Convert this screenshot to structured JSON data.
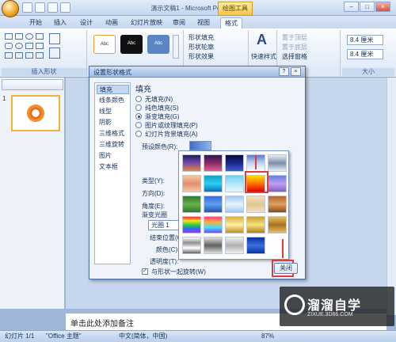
{
  "window": {
    "title": "演示文稿1 - Microsoft PowerPoint",
    "context_tab": "绘图工具"
  },
  "ribbon_tabs": [
    "开始",
    "插入",
    "设计",
    "动画",
    "幻灯片放映",
    "审阅",
    "视图",
    "格式"
  ],
  "active_tab": "格式",
  "ribbon": {
    "insert_shapes_label": "插入形状",
    "shape_fill": "形状填充",
    "shape_outline": "形状轮廓",
    "shape_effects": "形状效果",
    "quick_styles": "快速样式",
    "bring_forward": "置于顶层",
    "send_backward": "置于底层",
    "selection_pane": "选择窗格",
    "height_value": "8.4 厘米",
    "width_value": "8.4 厘米",
    "size_label": "大小",
    "style_sample": "Abc"
  },
  "slide_pane": {
    "slide_number": "1"
  },
  "dialog": {
    "title": "设置形状格式",
    "nav": [
      "填充",
      "线条颜色",
      "线型",
      "阴影",
      "三维格式",
      "三维旋转",
      "图片",
      "文本框"
    ],
    "section_title": "填充",
    "options": [
      "无填充(N)",
      "纯色填充(S)",
      "渐变填充(G)",
      "图片或纹理填充(P)",
      "幻灯片背景填充(A)"
    ],
    "preset_label": "预设颜色(R):",
    "type_label": "类型(Y):",
    "direction_label": "方向(D):",
    "angle_label": "角度(E):",
    "stops_label": "渐变光圈",
    "stop_value": "光圈 1",
    "position_label": "结束位置(O):",
    "color_label": "颜色(C):",
    "transparency_label": "透明度(T):",
    "rotate_label": "与形状一起旋转(W)",
    "close_label": "关闭"
  },
  "notes": {
    "placeholder": "单击此处添加备注"
  },
  "status": {
    "slide": "幻灯片 1/1",
    "theme": "\"Office 主题\"",
    "language": "中文(简体，中国)",
    "zoom": "87%"
  },
  "watermark": {
    "brand": "溜溜自学",
    "url": "ZIXUE.3D66.COM"
  }
}
